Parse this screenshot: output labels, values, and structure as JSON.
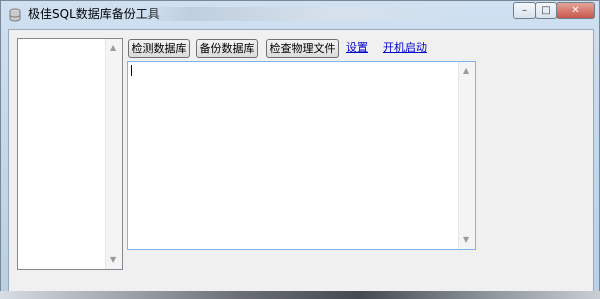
{
  "window": {
    "title": "极佳SQL数据库备份工具",
    "minimize_glyph": "–",
    "maximize_glyph": "□",
    "close_glyph": "✕"
  },
  "toolbar": {
    "check_db_label": "检测数据库",
    "backup_db_label": "备份数据库",
    "check_files_label": "检查物理文件",
    "settings_link": "设置",
    "autostart_link": "开机启动"
  },
  "scroll": {
    "up_glyph": "▲",
    "down_glyph": "▼"
  },
  "icons": {
    "app": "database-icon"
  },
  "colors": {
    "link": "#0000cc",
    "textarea_border": "#7eb4ea",
    "close_button": "#c8584a"
  }
}
